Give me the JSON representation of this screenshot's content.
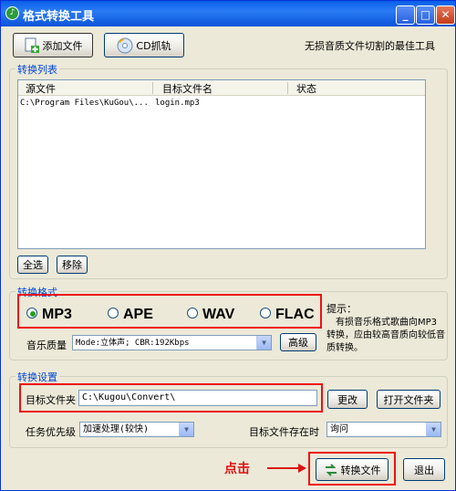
{
  "window": {
    "title": "格式转换工具",
    "min_icon": "minimize-icon",
    "max_icon": "maximize-icon",
    "close_icon": "close-icon"
  },
  "toolbar": {
    "add_file_label": "添加文件",
    "cd_rip_label": "CD抓轨",
    "slogan": "无损音质文件切割的最佳工具"
  },
  "convert_list": {
    "group_label": "转换列表",
    "columns": [
      "源文件",
      "目标文件名",
      "状态"
    ],
    "rows": [
      {
        "source": "C:\\Program Files\\KuGou\\...",
        "target": "login.mp3",
        "status": ""
      }
    ],
    "select_all_label": "全选",
    "remove_label": "移除"
  },
  "format": {
    "group_label": "转换格式",
    "options": [
      "MP3",
      "APE",
      "WAV",
      "FLAC"
    ],
    "selected": "MP3",
    "quality_label": "音乐质量",
    "quality_value": "Mode:立体声; CBR:192Kbps",
    "advanced_label": "高级",
    "hint_title": "提示：",
    "hint_text": "有损音乐格式歌曲向MP3转换，应由较高音质向较低音质转换。"
  },
  "settings": {
    "group_label": "转换设置",
    "target_folder_label": "目标文件夹",
    "target_folder_value": "C:\\Kugou\\Convert\\",
    "change_label": "更改",
    "open_folder_label": "打开文件夹",
    "priority_label": "任务优先级",
    "priority_value": "加速处理(较快)",
    "exists_label": "目标文件存在时",
    "exists_value": "询问"
  },
  "footer": {
    "annotation": "点击",
    "convert_label": "转换文件",
    "exit_label": "退出"
  },
  "colors": {
    "titlebar": "#0a5fe8",
    "group_label": "#0046d5",
    "highlight_box": "#ee1111",
    "annotation": "#dd1111"
  }
}
